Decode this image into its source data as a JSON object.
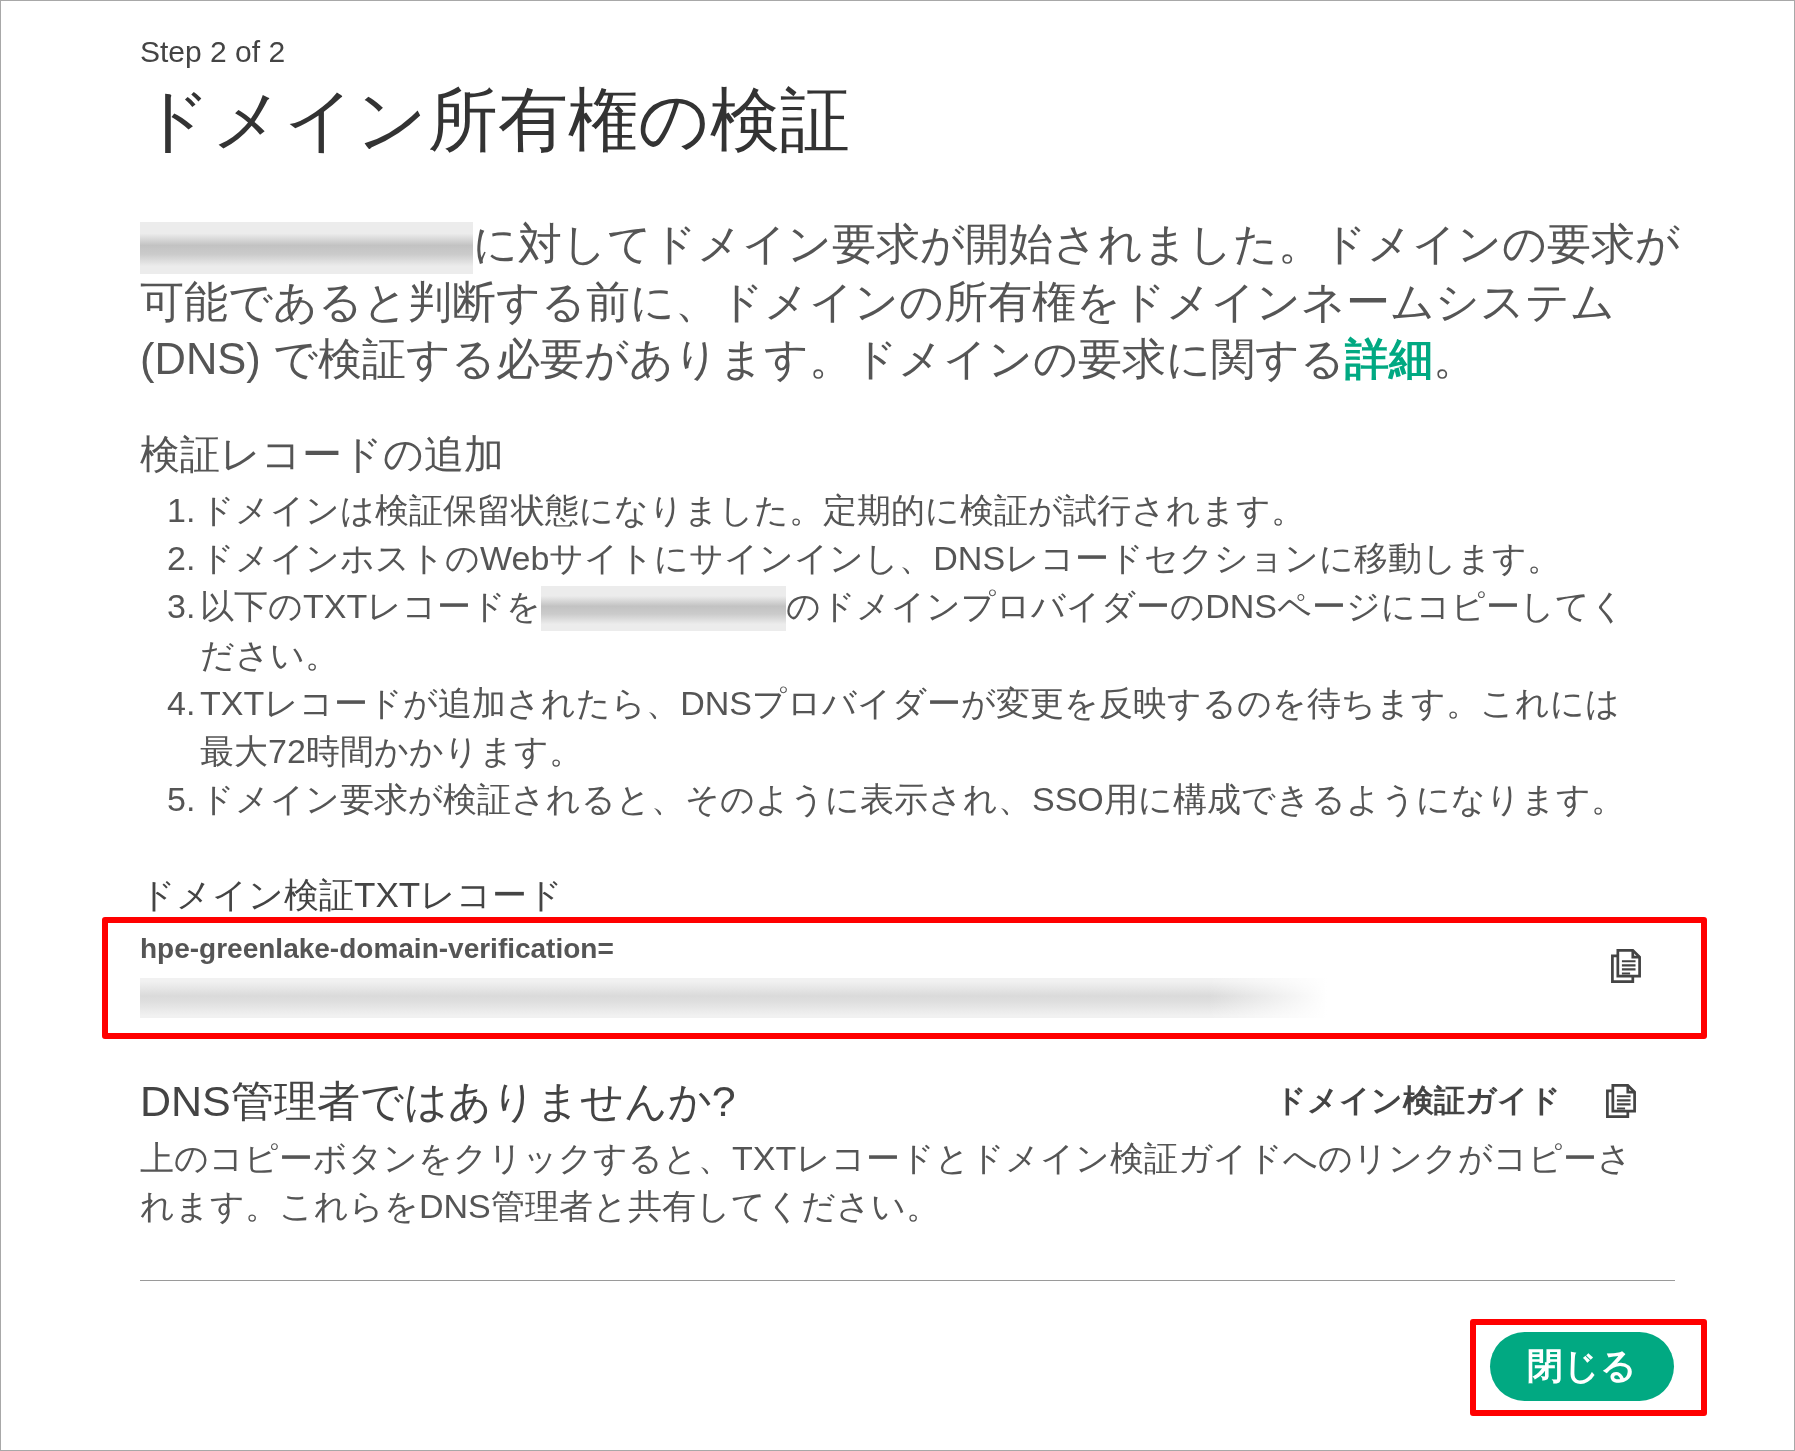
{
  "step": "Step 2 of 2",
  "title": "ドメイン所有権の検証",
  "intro": [
    {
      "kind": "redacted"
    },
    {
      "kind": "text",
      "text": "に対してドメイン要求が開始されました。ドメインの要求が可能であると判断する前に、ドメインの所有権をドメインネームシステム (DNS) で検証する必要があります。ドメインの要求に関する"
    },
    {
      "kind": "link",
      "text": "詳細"
    },
    {
      "kind": "text",
      "text": "。"
    }
  ],
  "add_record": {
    "heading": "検証レコードの追加",
    "steps": [
      {
        "number": "1.",
        "parts": [
          {
            "kind": "text",
            "text": "ドメインは検証保留状態になりました。定期的に検証が試行されます。"
          }
        ]
      },
      {
        "number": "2.",
        "parts": [
          {
            "kind": "text",
            "text": "ドメインホストのWebサイトにサインインし、DNSレコードセクションに移動します。"
          }
        ]
      },
      {
        "number": "3.",
        "parts": [
          {
            "kind": "text",
            "text": "以下のTXTレコードを"
          },
          {
            "kind": "redacted"
          },
          {
            "kind": "text",
            "text": "のドメインプロバイダーのDNSページにコピーしてください。"
          }
        ]
      },
      {
        "number": "4.",
        "parts": [
          {
            "kind": "text",
            "text": "TXTレコードが追加されたら、DNSプロバイダーが変更を反映するのを待ちます。これには最大72時間かかります。"
          }
        ]
      },
      {
        "number": "5.",
        "parts": [
          {
            "kind": "text",
            "text": "ドメイン要求が検証されると、そのように表示され、SSO用に構成できるようになります。"
          }
        ]
      }
    ]
  },
  "txt_record": {
    "label": "ドメイン検証TXTレコード",
    "highlighted": true,
    "value": [
      {
        "kind": "text",
        "text": "hpe-greenlake-domain-verification="
      },
      {
        "kind": "redacted"
      }
    ]
  },
  "not_admin": {
    "heading": "DNS管理者ではありませんか?",
    "guide_button": "ドメイン検証ガイド",
    "description": "上のコピーボタンをクリックすると、TXTレコードとドメイン検証ガイドへのリンクがコピーされます。これらをDNS管理者と共有してください。"
  },
  "footer": {
    "close_button": {
      "label": "閉じる",
      "highlighted": true
    }
  }
}
